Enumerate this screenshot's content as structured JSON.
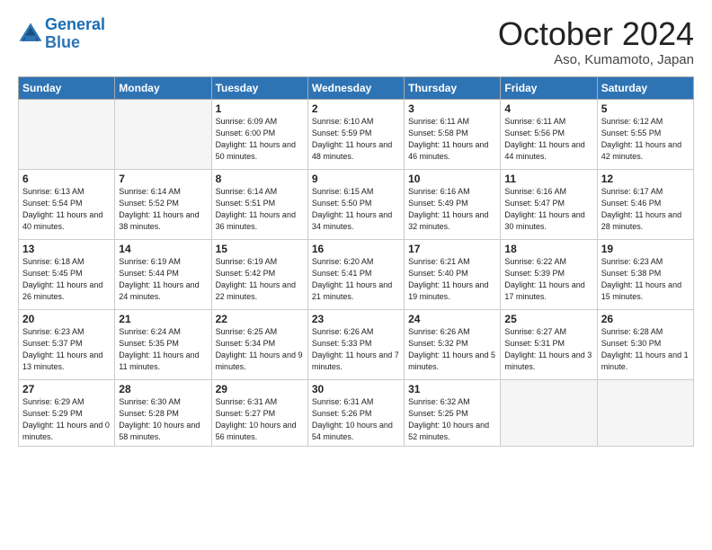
{
  "header": {
    "logo_line1": "General",
    "logo_line2": "Blue",
    "month": "October 2024",
    "location": "Aso, Kumamoto, Japan"
  },
  "days_of_week": [
    "Sunday",
    "Monday",
    "Tuesday",
    "Wednesday",
    "Thursday",
    "Friday",
    "Saturday"
  ],
  "weeks": [
    [
      {
        "day": "",
        "info": ""
      },
      {
        "day": "",
        "info": ""
      },
      {
        "day": "1",
        "info": "Sunrise: 6:09 AM\nSunset: 6:00 PM\nDaylight: 11 hours and 50 minutes."
      },
      {
        "day": "2",
        "info": "Sunrise: 6:10 AM\nSunset: 5:59 PM\nDaylight: 11 hours and 48 minutes."
      },
      {
        "day": "3",
        "info": "Sunrise: 6:11 AM\nSunset: 5:58 PM\nDaylight: 11 hours and 46 minutes."
      },
      {
        "day": "4",
        "info": "Sunrise: 6:11 AM\nSunset: 5:56 PM\nDaylight: 11 hours and 44 minutes."
      },
      {
        "day": "5",
        "info": "Sunrise: 6:12 AM\nSunset: 5:55 PM\nDaylight: 11 hours and 42 minutes."
      }
    ],
    [
      {
        "day": "6",
        "info": "Sunrise: 6:13 AM\nSunset: 5:54 PM\nDaylight: 11 hours and 40 minutes."
      },
      {
        "day": "7",
        "info": "Sunrise: 6:14 AM\nSunset: 5:52 PM\nDaylight: 11 hours and 38 minutes."
      },
      {
        "day": "8",
        "info": "Sunrise: 6:14 AM\nSunset: 5:51 PM\nDaylight: 11 hours and 36 minutes."
      },
      {
        "day": "9",
        "info": "Sunrise: 6:15 AM\nSunset: 5:50 PM\nDaylight: 11 hours and 34 minutes."
      },
      {
        "day": "10",
        "info": "Sunrise: 6:16 AM\nSunset: 5:49 PM\nDaylight: 11 hours and 32 minutes."
      },
      {
        "day": "11",
        "info": "Sunrise: 6:16 AM\nSunset: 5:47 PM\nDaylight: 11 hours and 30 minutes."
      },
      {
        "day": "12",
        "info": "Sunrise: 6:17 AM\nSunset: 5:46 PM\nDaylight: 11 hours and 28 minutes."
      }
    ],
    [
      {
        "day": "13",
        "info": "Sunrise: 6:18 AM\nSunset: 5:45 PM\nDaylight: 11 hours and 26 minutes."
      },
      {
        "day": "14",
        "info": "Sunrise: 6:19 AM\nSunset: 5:44 PM\nDaylight: 11 hours and 24 minutes."
      },
      {
        "day": "15",
        "info": "Sunrise: 6:19 AM\nSunset: 5:42 PM\nDaylight: 11 hours and 22 minutes."
      },
      {
        "day": "16",
        "info": "Sunrise: 6:20 AM\nSunset: 5:41 PM\nDaylight: 11 hours and 21 minutes."
      },
      {
        "day": "17",
        "info": "Sunrise: 6:21 AM\nSunset: 5:40 PM\nDaylight: 11 hours and 19 minutes."
      },
      {
        "day": "18",
        "info": "Sunrise: 6:22 AM\nSunset: 5:39 PM\nDaylight: 11 hours and 17 minutes."
      },
      {
        "day": "19",
        "info": "Sunrise: 6:23 AM\nSunset: 5:38 PM\nDaylight: 11 hours and 15 minutes."
      }
    ],
    [
      {
        "day": "20",
        "info": "Sunrise: 6:23 AM\nSunset: 5:37 PM\nDaylight: 11 hours and 13 minutes."
      },
      {
        "day": "21",
        "info": "Sunrise: 6:24 AM\nSunset: 5:35 PM\nDaylight: 11 hours and 11 minutes."
      },
      {
        "day": "22",
        "info": "Sunrise: 6:25 AM\nSunset: 5:34 PM\nDaylight: 11 hours and 9 minutes."
      },
      {
        "day": "23",
        "info": "Sunrise: 6:26 AM\nSunset: 5:33 PM\nDaylight: 11 hours and 7 minutes."
      },
      {
        "day": "24",
        "info": "Sunrise: 6:26 AM\nSunset: 5:32 PM\nDaylight: 11 hours and 5 minutes."
      },
      {
        "day": "25",
        "info": "Sunrise: 6:27 AM\nSunset: 5:31 PM\nDaylight: 11 hours and 3 minutes."
      },
      {
        "day": "26",
        "info": "Sunrise: 6:28 AM\nSunset: 5:30 PM\nDaylight: 11 hours and 1 minute."
      }
    ],
    [
      {
        "day": "27",
        "info": "Sunrise: 6:29 AM\nSunset: 5:29 PM\nDaylight: 11 hours and 0 minutes."
      },
      {
        "day": "28",
        "info": "Sunrise: 6:30 AM\nSunset: 5:28 PM\nDaylight: 10 hours and 58 minutes."
      },
      {
        "day": "29",
        "info": "Sunrise: 6:31 AM\nSunset: 5:27 PM\nDaylight: 10 hours and 56 minutes."
      },
      {
        "day": "30",
        "info": "Sunrise: 6:31 AM\nSunset: 5:26 PM\nDaylight: 10 hours and 54 minutes."
      },
      {
        "day": "31",
        "info": "Sunrise: 6:32 AM\nSunset: 5:25 PM\nDaylight: 10 hours and 52 minutes."
      },
      {
        "day": "",
        "info": ""
      },
      {
        "day": "",
        "info": ""
      }
    ]
  ]
}
